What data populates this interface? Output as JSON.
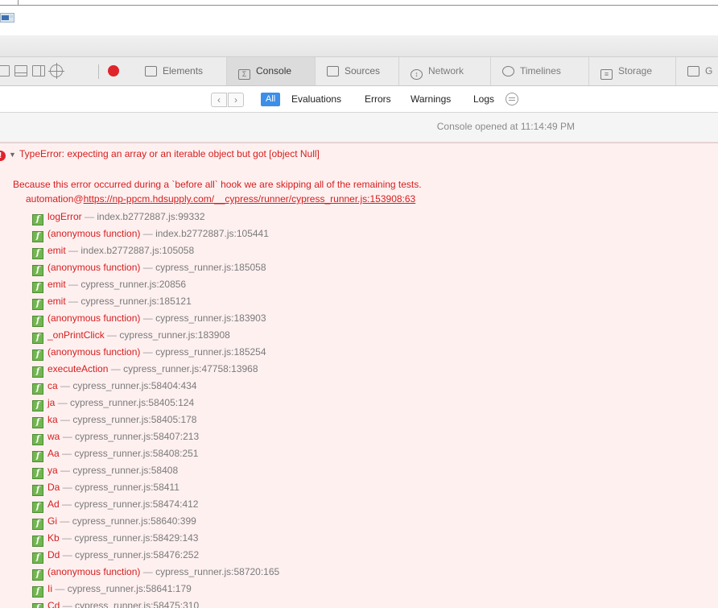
{
  "toolbar": {
    "tabs": [
      {
        "label": "Elements",
        "icon": "elements-icon"
      },
      {
        "label": "Console",
        "icon": "console-icon"
      },
      {
        "label": "Sources",
        "icon": "sources-icon"
      },
      {
        "label": "Network",
        "icon": "network-icon"
      },
      {
        "label": "Timelines",
        "icon": "timelines-icon"
      },
      {
        "label": "Storage",
        "icon": "storage-icon"
      },
      {
        "label": "G",
        "icon": "graphics-icon"
      }
    ],
    "active_tab": "Console"
  },
  "filter": {
    "back": "‹",
    "forward": "›",
    "scopes": [
      "All",
      "Evaluations",
      "Errors",
      "Warnings",
      "Logs"
    ],
    "active_scope": "All"
  },
  "console": {
    "opened_text": "Console opened at 11:14:49 PM",
    "error": {
      "title": "TypeError: expecting an array or an iterable object but got [object Null]",
      "message": "Because this error occurred during a `before all` hook we are skipping all of the remaining tests.",
      "location_prefix": "automation@",
      "location_url": "https://np-ppcm.hdsupply.com/__cypress/runner/cypress_runner.js:153908:63",
      "frames": [
        {
          "fn": "logError",
          "loc": "index.b2772887.js:99332"
        },
        {
          "fn": "(anonymous function)",
          "loc": "index.b2772887.js:105441"
        },
        {
          "fn": "emit",
          "loc": "index.b2772887.js:105058"
        },
        {
          "fn": "(anonymous function)",
          "loc": "cypress_runner.js:185058"
        },
        {
          "fn": "emit",
          "loc": "cypress_runner.js:20856"
        },
        {
          "fn": "emit",
          "loc": "cypress_runner.js:185121"
        },
        {
          "fn": "(anonymous function)",
          "loc": "cypress_runner.js:183903"
        },
        {
          "fn": "_onPrintClick",
          "loc": "cypress_runner.js:183908"
        },
        {
          "fn": "(anonymous function)",
          "loc": "cypress_runner.js:185254"
        },
        {
          "fn": "executeAction",
          "loc": "cypress_runner.js:47758:13968"
        },
        {
          "fn": "ca",
          "loc": "cypress_runner.js:58404:434"
        },
        {
          "fn": "ja",
          "loc": "cypress_runner.js:58405:124"
        },
        {
          "fn": "ka",
          "loc": "cypress_runner.js:58405:178"
        },
        {
          "fn": "wa",
          "loc": "cypress_runner.js:58407:213"
        },
        {
          "fn": "Aa",
          "loc": "cypress_runner.js:58408:251"
        },
        {
          "fn": "ya",
          "loc": "cypress_runner.js:58408"
        },
        {
          "fn": "Da",
          "loc": "cypress_runner.js:58411"
        },
        {
          "fn": "Ad",
          "loc": "cypress_runner.js:58474:412"
        },
        {
          "fn": "Gi",
          "loc": "cypress_runner.js:58640:399"
        },
        {
          "fn": "Kb",
          "loc": "cypress_runner.js:58429:143"
        },
        {
          "fn": "Dd",
          "loc": "cypress_runner.js:58476:252"
        },
        {
          "fn": "(anonymous function)",
          "loc": "cypress_runner.js:58720:165"
        },
        {
          "fn": "Ii",
          "loc": "cypress_runner.js:58641:179"
        },
        {
          "fn": "Cd",
          "loc": "cypress_runner.js:58475:310"
        }
      ],
      "frame_separator": "—",
      "frame_icon_glyph": "f"
    }
  }
}
